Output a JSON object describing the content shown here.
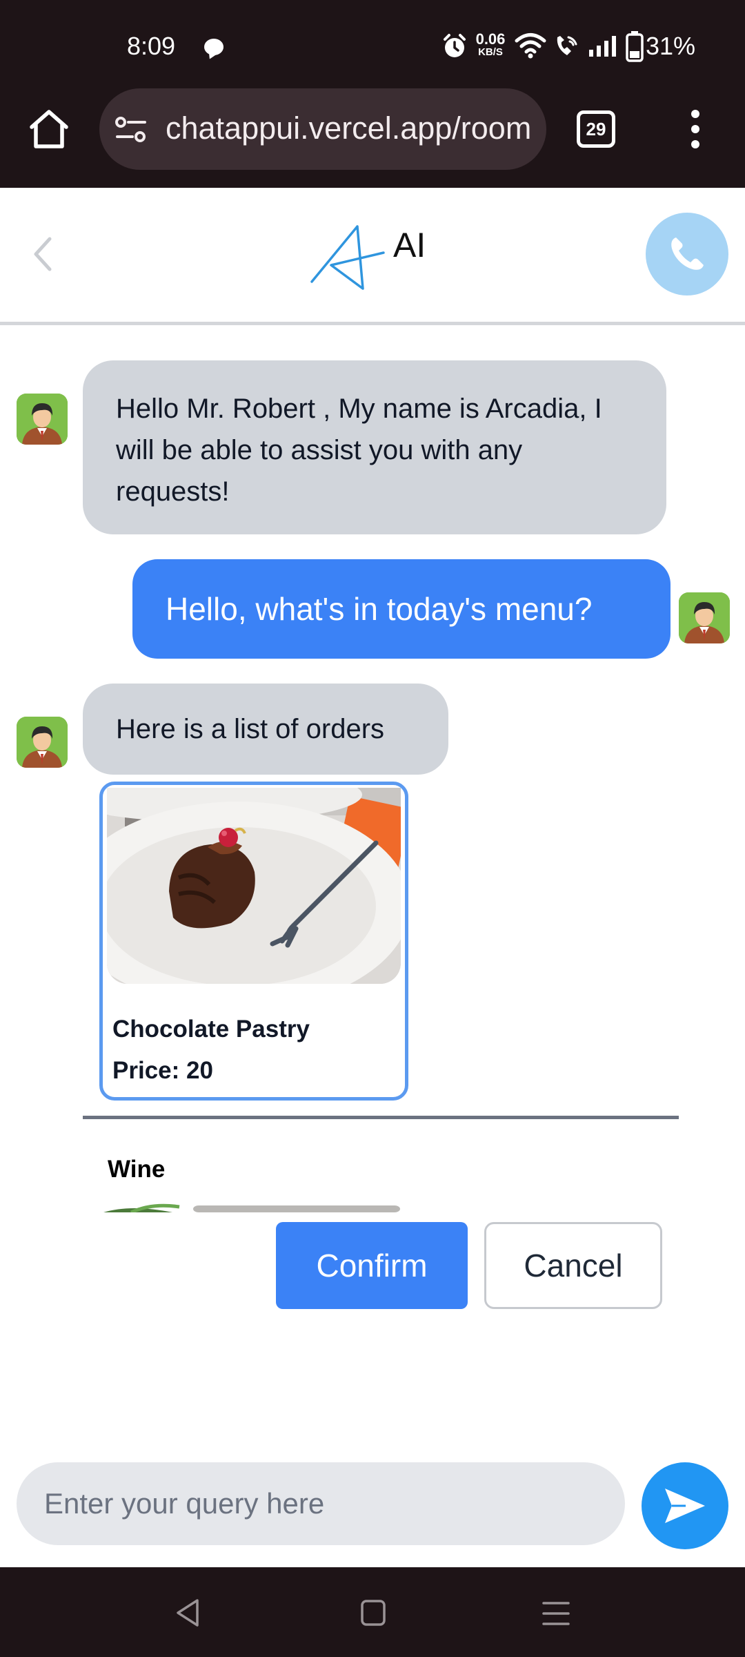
{
  "status_bar": {
    "time": "8:09",
    "net_speed_value": "0.06",
    "net_speed_unit": "KB/S",
    "battery": "31%"
  },
  "browser": {
    "url": "chatappui.vercel.app/room",
    "tab_count": "29"
  },
  "header": {
    "title": "AI"
  },
  "messages": [
    {
      "sender": "bot",
      "text": "Hello Mr. Robert , My name is Arcadia, I will be able to assist you with any requests!"
    },
    {
      "sender": "user",
      "text": "Hello, what's in today's menu?"
    },
    {
      "sender": "bot",
      "text": "Here is a list of orders"
    }
  ],
  "menu_items": [
    {
      "name": "Chocolate Pastry",
      "price_label": "Price: 20"
    },
    {
      "name": "Wine"
    }
  ],
  "actions": {
    "confirm_label": "Confirm",
    "cancel_label": "Cancel"
  },
  "composer": {
    "placeholder": "Enter your query here"
  },
  "colors": {
    "primary": "#3b82f6",
    "bot_bubble": "#d1d5db",
    "call_button": "#a6d4f5",
    "send_button": "#2196f3"
  },
  "icons": [
    "home-icon",
    "site-settings-icon",
    "more-vert-icon",
    "back-chevron-icon",
    "logo-icon",
    "phone-icon",
    "avatar-icon",
    "send-icon"
  ]
}
